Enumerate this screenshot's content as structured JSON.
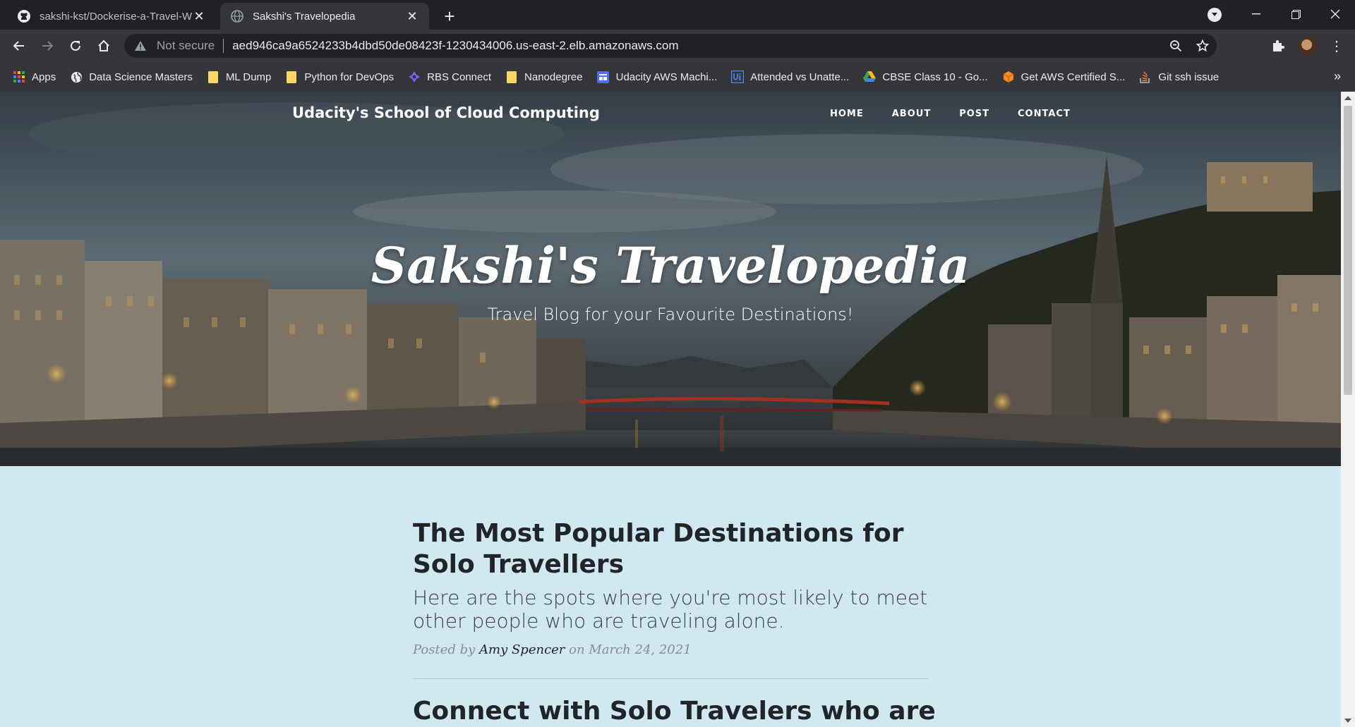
{
  "browser": {
    "tabs": [
      {
        "title": "sakshi-kst/Dockerise-a-Travel-We",
        "icon": "github-icon",
        "active": false
      },
      {
        "title": "Sakshi's Travelopedia",
        "icon": "globe-icon",
        "active": true
      }
    ],
    "new_tab": "+",
    "security_label": "Not secure",
    "url": "aed946ca9a6524233b4dbd50de08423f-1230434006.us-east-2.elb.amazonaws.com"
  },
  "bookmarks": [
    {
      "label": "Apps",
      "icon": "apps-grid-icon"
    },
    {
      "label": "Data Science Masters",
      "icon": "globe-icon"
    },
    {
      "label": "ML Dump",
      "icon": "folder-icon"
    },
    {
      "label": "Python for DevOps",
      "icon": "folder-icon"
    },
    {
      "label": "RBS Connect",
      "icon": "rbs-logo-icon"
    },
    {
      "label": "Nanodegree",
      "icon": "folder-icon"
    },
    {
      "label": "Udacity AWS Machi...",
      "icon": "doc-icon"
    },
    {
      "label": "Attended vs Unatte...",
      "icon": "uipath-icon"
    },
    {
      "label": "CBSE Class 10 - Go...",
      "icon": "google-drive-icon"
    },
    {
      "label": "Get AWS Certified S...",
      "icon": "aws-cube-icon"
    },
    {
      "label": "Git ssh issue",
      "icon": "stackoverflow-icon"
    }
  ],
  "site": {
    "brand": "Udacity's School of Cloud Computing",
    "nav": [
      "HOME",
      "ABOUT",
      "POST",
      "CONTACT"
    ],
    "hero_title": "Sakshi's Travelopedia",
    "hero_subtitle": "Travel Blog for your Favourite Destinations!"
  },
  "posts": [
    {
      "title": "The Most Popular Destinations for Solo Travellers",
      "subtitle": "Here are the spots where you're most likely to meet other people who are traveling alone.",
      "posted_by": "Posted by",
      "author": "Amy Spencer",
      "date_prefix": "on",
      "date": "March 24, 2021"
    },
    {
      "title": "Connect with Solo Travelers who are"
    }
  ],
  "colors": {
    "chrome_dark": "#202124",
    "chrome_toolbar": "#35363a",
    "page_background": "#cfe8f2"
  }
}
